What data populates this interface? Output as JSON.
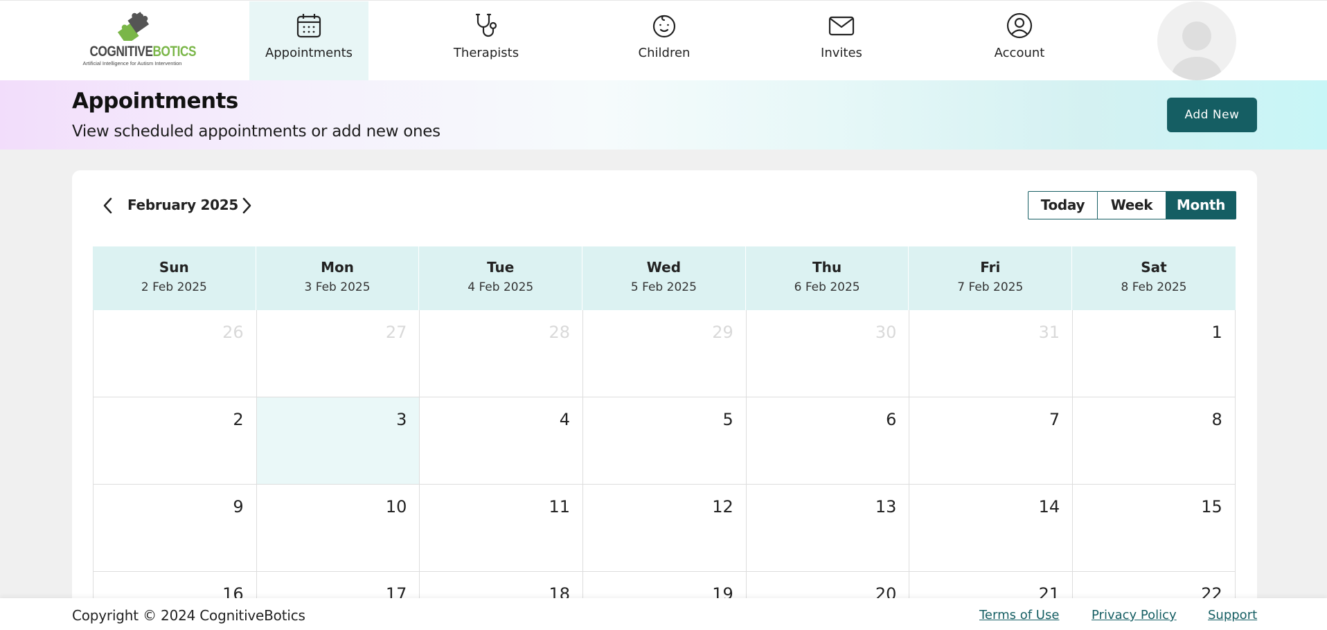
{
  "brand": {
    "word_part1": "COGNITIVE",
    "word_part2": "BOTICS",
    "tagline": "Artificial Intelligence for Autism Intervention",
    "dark_color": "#444444",
    "green_color": "#7ab648"
  },
  "nav": {
    "items": [
      {
        "label": "Appointments",
        "icon": "calendar-icon",
        "active": true
      },
      {
        "label": "Therapists",
        "icon": "stethoscope-icon",
        "active": false
      },
      {
        "label": "Children",
        "icon": "baby-face-icon",
        "active": false
      },
      {
        "label": "Invites",
        "icon": "envelope-icon",
        "active": false
      },
      {
        "label": "Account",
        "icon": "user-circle-icon",
        "active": false
      }
    ],
    "avatar_icon": "avatar-placeholder-icon"
  },
  "header": {
    "title": "Appointments",
    "subtitle": "View scheduled appointments or add new ones",
    "add_button": "Add New"
  },
  "calendar": {
    "month_label": "February 2025",
    "prev_icon": "chevron-left-icon",
    "next_icon": "chevron-right-icon",
    "views": {
      "today": "Today",
      "week": "Week",
      "month": "Month",
      "selected": "Month"
    },
    "headers": [
      {
        "day": "Sun",
        "date": "2 Feb 2025"
      },
      {
        "day": "Mon",
        "date": "3 Feb 2025"
      },
      {
        "day": "Tue",
        "date": "4 Feb 2025"
      },
      {
        "day": "Wed",
        "date": "5 Feb 2025"
      },
      {
        "day": "Thu",
        "date": "6 Feb 2025"
      },
      {
        "day": "Fri",
        "date": "7 Feb 2025"
      },
      {
        "day": "Sat",
        "date": "8 Feb 2025"
      }
    ],
    "weeks": [
      [
        {
          "n": "26",
          "outside": true
        },
        {
          "n": "27",
          "outside": true
        },
        {
          "n": "28",
          "outside": true
        },
        {
          "n": "29",
          "outside": true
        },
        {
          "n": "30",
          "outside": true
        },
        {
          "n": "31",
          "outside": true
        },
        {
          "n": "1",
          "outside": false
        }
      ],
      [
        {
          "n": "2",
          "outside": false
        },
        {
          "n": "3",
          "outside": false,
          "today": true
        },
        {
          "n": "4",
          "outside": false
        },
        {
          "n": "5",
          "outside": false
        },
        {
          "n": "6",
          "outside": false
        },
        {
          "n": "7",
          "outside": false
        },
        {
          "n": "8",
          "outside": false
        }
      ],
      [
        {
          "n": "9",
          "outside": false
        },
        {
          "n": "10",
          "outside": false
        },
        {
          "n": "11",
          "outside": false
        },
        {
          "n": "12",
          "outside": false
        },
        {
          "n": "13",
          "outside": false
        },
        {
          "n": "14",
          "outside": false
        },
        {
          "n": "15",
          "outside": false
        }
      ],
      [
        {
          "n": "16",
          "outside": false
        },
        {
          "n": "17",
          "outside": false
        },
        {
          "n": "18",
          "outside": false
        },
        {
          "n": "19",
          "outside": false
        },
        {
          "n": "20",
          "outside": false
        },
        {
          "n": "21",
          "outside": false
        },
        {
          "n": "22",
          "outside": false
        }
      ]
    ]
  },
  "footer": {
    "copyright": "Copyright © 2024 CognitiveBotics",
    "links": [
      "Terms of Use",
      "Privacy Policy",
      "Support"
    ]
  },
  "colors": {
    "accent": "#155e63",
    "header_row": "#dcf2f2",
    "today_cell": "#eaf8f8"
  }
}
